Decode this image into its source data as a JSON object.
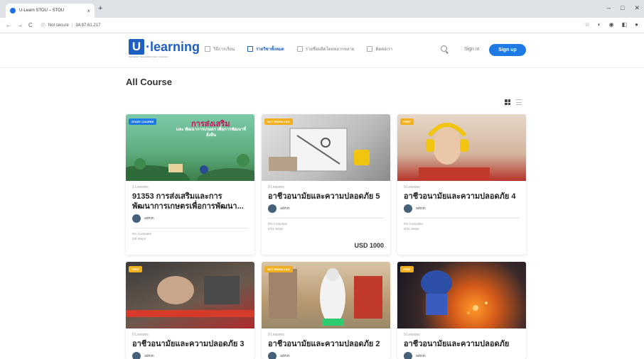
{
  "browser": {
    "tab_title": "U-Learn STOU – STOU",
    "tab_close": "×",
    "new_tab": "+",
    "window_controls": [
      "–",
      "□",
      "✕"
    ],
    "nav": [
      "←",
      "→",
      "C"
    ],
    "security": "Not secure",
    "address": "34.87.61.217",
    "ext_icons": [
      "☆",
      "◐",
      "◉",
      "◧",
      "●"
    ]
  },
  "site": {
    "logo_letter": "U",
    "logo_text": "·learning",
    "logo_sub": "Sukhothai Thammathirat Open University",
    "menu": [
      {
        "label": "วิธีการเรียน",
        "icon": "book-icon",
        "active": false
      },
      {
        "label": "รายวิชาทั้งหมด",
        "icon": "grid-icon",
        "active": true
      },
      {
        "label": "รายชื่อผลิตโดยหลากหลาย",
        "icon": "document-icon",
        "active": false
      },
      {
        "label": "ติดต่อเรา",
        "icon": "contact-icon",
        "active": false
      }
    ],
    "signin": "Sign in",
    "signup": "Sign up"
  },
  "page": {
    "title": "All Course"
  },
  "courses": [
    {
      "badge": "START COURSE",
      "badge_color": "#1e7be6",
      "lessons": "1 Lessons",
      "title": "91353 การส่งเสริมและการพัฒนาการเกษตรเพื่อการพัฒนา...",
      "author": "admin",
      "progress": "0% Complete",
      "steps": "0/5 Steps",
      "price": "",
      "img_colors": [
        "#7cc9a8",
        "#3d7f4a"
      ],
      "img_text_main": "การส่งเสริม",
      "img_text_sub": "และ พัฒนาการเกษตร เพื่อการพัฒนาที่ยั่งยืน"
    },
    {
      "badge": "NOT ENROLLED",
      "badge_color": "#f2b01e",
      "lessons": "0 Lessons",
      "title": "อาชีวอนามัยและความปลอดภัย 5",
      "author": "admin",
      "progress": "0% Complete",
      "steps": "0/31 Steps",
      "price": "USD 1000",
      "img_colors": [
        "#cfcfcf",
        "#8a8a8a"
      ],
      "img_text_main": "",
      "img_text_sub": ""
    },
    {
      "badge": "FREE",
      "badge_color": "#f2b01e",
      "lessons": "0 Lessons",
      "title": "อาชีวอนามัยและความปลอดภัย 4",
      "author": "admin",
      "progress": "0% Complete",
      "steps": "0/31 Steps",
      "price": "",
      "img_colors": [
        "#d9c2b0",
        "#b5332a"
      ],
      "img_text_main": "",
      "img_text_sub": ""
    },
    {
      "badge": "FREE",
      "badge_color": "#f2b01e",
      "lessons": "0 Lessons",
      "title": "อาชีวอนามัยและความปลอดภัย 3",
      "author": "admin",
      "progress": "",
      "steps": "",
      "price": "",
      "img_colors": [
        "#5a4a3e",
        "#b02b2b"
      ],
      "img_text_main": "",
      "img_text_sub": ""
    },
    {
      "badge": "NOT ENROLLED",
      "badge_color": "#f2b01e",
      "lessons": "0 Lessons",
      "title": "อาชีวอนามัยและความปลอดภัย 2",
      "author": "admin",
      "progress": "",
      "steps": "",
      "price": "",
      "img_colors": [
        "#c9b28f",
        "#e8e8e8"
      ],
      "img_text_main": "",
      "img_text_sub": ""
    },
    {
      "badge": "FREE",
      "badge_color": "#f2b01e",
      "lessons": "0 Lessons",
      "title": "อาชีวอนามัยและความปลอดภัย",
      "author": "admin",
      "progress": "",
      "steps": "",
      "price": "",
      "img_colors": [
        "#1a1a2a",
        "#d45a1a"
      ],
      "img_text_main": "",
      "img_text_sub": ""
    }
  ]
}
